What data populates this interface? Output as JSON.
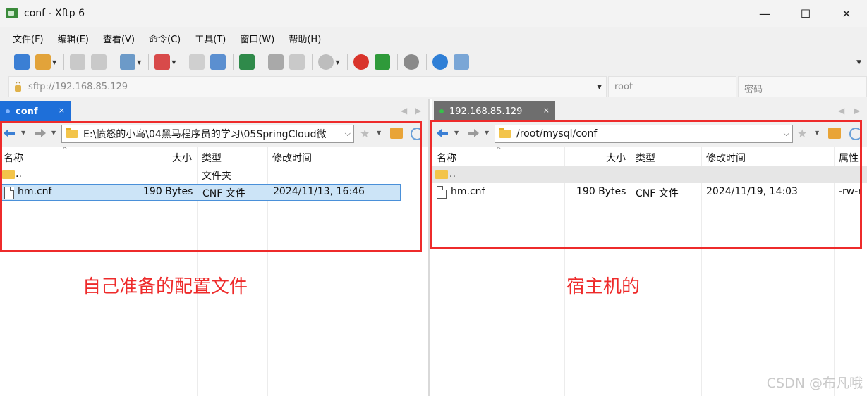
{
  "window": {
    "title": "conf - Xftp 6",
    "min_label": "—",
    "max_label": "☐",
    "close_label": "✕"
  },
  "menu": [
    "文件(F)",
    "编辑(E)",
    "查看(V)",
    "命令(C)",
    "工具(T)",
    "窗口(W)",
    "帮助(H)"
  ],
  "toolbar": {
    "icons": [
      "new-session-icon",
      "open-folder-icon",
      "connect-icon",
      "disconnect-icon",
      "settings-session-icon",
      "terminal-icon",
      "copy-icon",
      "paste-icon",
      "transfer-icon",
      "log-icon",
      "log-off-icon",
      "record-icon",
      "xshell-icon",
      "xftp-icon",
      "gear-icon",
      "help-icon",
      "chat-icon"
    ]
  },
  "address": {
    "host_placeholder": "sftp://192.168.85.129",
    "user_placeholder": "root",
    "password_placeholder": "密码"
  },
  "left_pane": {
    "tab_label": "conf",
    "tab_close": "×",
    "path": "E:\\愤怒的小鸟\\04黑马程序员的学习\\05SpringCloud微",
    "columns": [
      "名称",
      "大小",
      "类型",
      "修改时间"
    ],
    "rows": [
      {
        "name": "..",
        "size": "",
        "type": "文件夹",
        "modified": ""
      },
      {
        "name": "hm.cnf",
        "size": "190 Bytes",
        "type": "CNF 文件",
        "modified": "2024/11/13, 16:46"
      }
    ]
  },
  "right_pane": {
    "tab_label": "192.168.85.129",
    "tab_close": "×",
    "path": "/root/mysql/conf",
    "columns": [
      "名称",
      "大小",
      "类型",
      "修改时间",
      "属性"
    ],
    "rows": [
      {
        "name": "..",
        "size": "",
        "type": "",
        "modified": "",
        "attrs": ""
      },
      {
        "name": "hm.cnf",
        "size": "190 Bytes",
        "type": "CNF 文件",
        "modified": "2024/11/19, 14:03",
        "attrs": "-rw-r"
      }
    ]
  },
  "annotations": {
    "left": "自己准备的配置文件",
    "right": "宿主机的"
  },
  "watermark": "CSDN @布凡哦",
  "colors": {
    "annotation": "#ee2b2b",
    "active_tab": "#1e6fd9",
    "selection": "#cce4f7"
  }
}
